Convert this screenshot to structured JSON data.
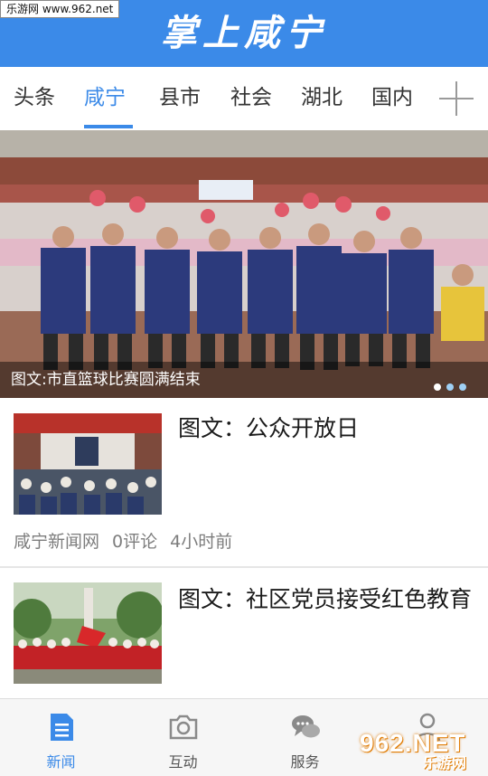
{
  "watermark": "乐游网 www.962.net",
  "header": {
    "title": "掌上咸宁"
  },
  "tabs": [
    {
      "label": "头条",
      "active": false
    },
    {
      "label": "咸宁",
      "active": true
    },
    {
      "label": "县市",
      "active": false
    },
    {
      "label": "社会",
      "active": false
    },
    {
      "label": "湖北",
      "active": false
    },
    {
      "label": "国内",
      "active": false
    }
  ],
  "add_tab_icon": "plus-icon",
  "banner": {
    "caption": "图文:市直篮球比赛圆满结束",
    "slides": 3,
    "active_slide": 1
  },
  "news": [
    {
      "title": "图文：公众开放日",
      "source": "咸宁新闻网",
      "comments": "0评论",
      "time": "4小时前"
    },
    {
      "title": "图文：社区党员接受红色教育"
    }
  ],
  "bottom_nav": [
    {
      "label": "新闻",
      "icon": "document-icon",
      "active": true
    },
    {
      "label": "互动",
      "icon": "camera-icon",
      "active": false
    },
    {
      "label": "服务",
      "icon": "chat-bubbles-icon",
      "active": false
    },
    {
      "label": "",
      "icon": "person-icon",
      "active": false
    }
  ],
  "corner_logo": {
    "text": "962.NET",
    "sub": "乐游网"
  },
  "colors": {
    "accent": "#3b8ae8",
    "divider": "#e6e6e6",
    "meta_text": "#7d7d7d"
  }
}
